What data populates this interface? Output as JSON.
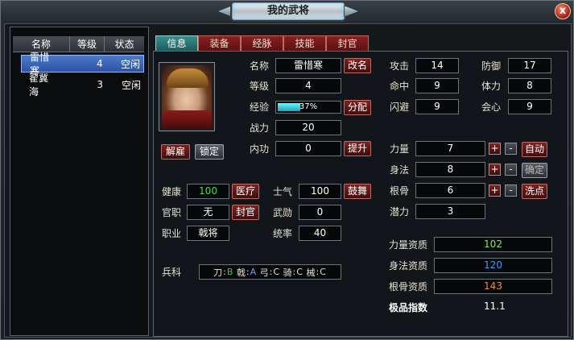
{
  "window": {
    "title": "我的武将",
    "close_label": "x"
  },
  "general_list": {
    "headers": [
      "名称",
      "等级",
      "状态"
    ],
    "rows": [
      {
        "name": "雷惜寒",
        "level": "4",
        "status": "空闲",
        "selected": true
      },
      {
        "name": "翟冀海",
        "level": "3",
        "status": "空闲",
        "selected": false
      }
    ]
  },
  "tabs": [
    "信息",
    "装备",
    "经脉",
    "技能",
    "封官"
  ],
  "active_tab": "信息",
  "portrait_buttons": {
    "dismiss": "解雇",
    "lock": "锁定"
  },
  "info": {
    "name_label": "名称",
    "name": "雷惜寒",
    "rename_button": "改名",
    "level_label": "等级",
    "level": "4",
    "exp_label": "经验",
    "exp_text": "37%",
    "exp_progress": 0.37,
    "distribute_button": "分配",
    "power_label": "战力",
    "power": "20",
    "inner_label": "内功",
    "inner": "0",
    "upgrade_button": "提升"
  },
  "combat": {
    "attack_label": "攻击",
    "attack": "14",
    "defense_label": "防御",
    "defense": "17",
    "hit_label": "命中",
    "hit": "9",
    "stamina_label": "体力",
    "stamina": "8",
    "dodge_label": "闪避",
    "dodge": "9",
    "crit_label": "会心",
    "crit": "9"
  },
  "attributes": {
    "strength_label": "力量",
    "strength": "7",
    "agility_label": "身法",
    "agility": "8",
    "constitution_label": "根骨",
    "constitution": "6",
    "potential_label": "潜力",
    "potential": "3",
    "plus": "+",
    "minus": "-",
    "auto_button": "自动",
    "confirm_button": "确定",
    "reset_button": "洗点"
  },
  "status": {
    "health_label": "健康",
    "health": "100",
    "heal_button": "医疗",
    "morale_label": "士气",
    "morale": "100",
    "inspire_button": "鼓舞",
    "office_label": "官职",
    "office": "无",
    "appoint_button": "封官",
    "merit_label": "武勋",
    "merit": "0",
    "job_label": "职业",
    "job": "戟将",
    "command_label": "统率",
    "command": "40"
  },
  "troops": {
    "label": "兵科",
    "items": [
      {
        "name": "刀",
        "grade": "B"
      },
      {
        "name": "戟",
        "grade": "A"
      },
      {
        "name": "弓",
        "grade": "C"
      },
      {
        "name": "骑",
        "grade": "C"
      },
      {
        "name": "械",
        "grade": "C"
      }
    ],
    "separator": ":"
  },
  "aptitude": {
    "strength_label": "力量资质",
    "strength": "102",
    "agility_label": "身法资质",
    "agility": "120",
    "constitution_label": "根骨资质",
    "constitution": "143",
    "quality_label": "极品指数",
    "quality": "11.1"
  },
  "colors": {
    "health": "#52d657",
    "strength_aptitude": "#86e86b",
    "agility_aptitude": "#3f9cf2",
    "constitution_aptitude": "#f08a3a",
    "exp_bar": "#1da3b5",
    "selected_row": "#2b53a6"
  }
}
